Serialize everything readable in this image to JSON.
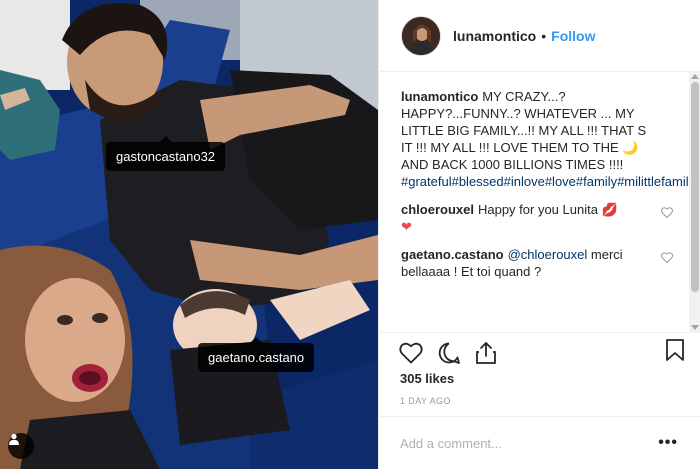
{
  "post": {
    "author": "lunamontico",
    "follow_label": "Follow",
    "separator": "•"
  },
  "photo": {
    "tags": [
      {
        "username": "gastoncastano32"
      },
      {
        "username": "gaetano.castano"
      }
    ],
    "user_tag_icon": "person-icon"
  },
  "caption": {
    "username": "lunamontico",
    "text": "MY CRAZY...? HAPPY?...FUNNY..? WHATEVER ... MY LITTLE BIG FAMILY...!! MY ALL !!! THAT S IT !!! MY ALL !!! LOVE THEM TO THE 🌙 AND BACK 1000 BILLIONS TIMES !!!!",
    "hashtags": "#grateful#blessed#inlove#love#family#milittlefamily#mylittlebigfamily#crazy#funny#happy#myall#lovetothemoonandback#bali#balifamilylife#balilife"
  },
  "comments": [
    {
      "username": "chloerouxel",
      "text": "Happy for you Lunita 💋",
      "emoji_line": "❤"
    },
    {
      "username": "gaetano.castano",
      "mention": "@chloerouxel",
      "text": "merci bellaaaa ! Et toi quand ?"
    }
  ],
  "engagement": {
    "likes": "305 likes",
    "time_ago": "1 DAY AGO"
  },
  "comment_box": {
    "placeholder": "Add a comment...",
    "more_label": "•••"
  },
  "colors": {
    "link_blue": "#3897f0",
    "hashtag_navy": "#003569",
    "border": "#efefef",
    "muted": "#999999"
  },
  "icons": [
    "heart-icon",
    "comment-icon",
    "share-icon",
    "bookmark-icon",
    "more-icon",
    "person-icon"
  ]
}
